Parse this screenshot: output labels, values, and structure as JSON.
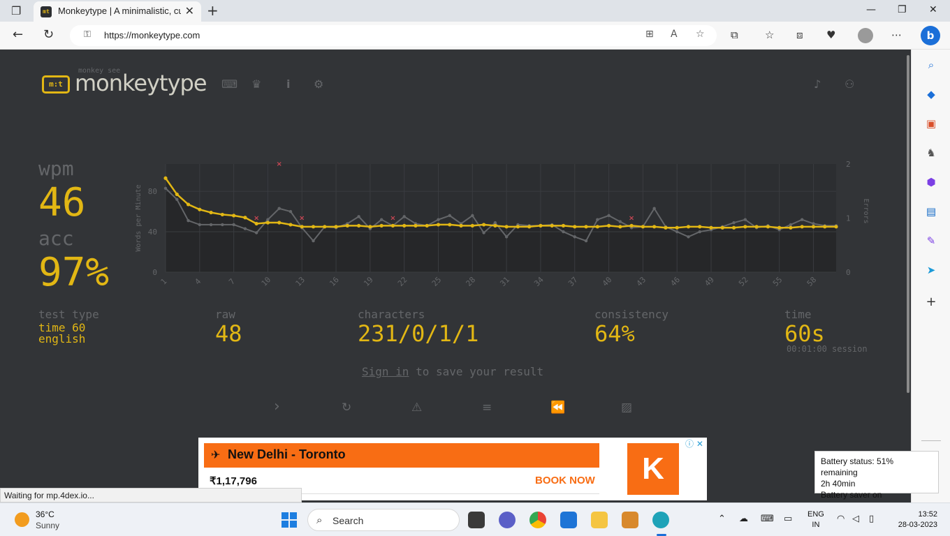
{
  "browser": {
    "tab_title": "Monkeytype | A minimalistic, customizable typing test",
    "favicon_text": "mt",
    "url": "https://monkeytype.com"
  },
  "site": {
    "logo_sub": "monkey see",
    "logo_text": "monkeytype",
    "logo_icon_text": "m:t"
  },
  "results": {
    "wpm_label": "wpm",
    "wpm_value": "46",
    "acc_label": "acc",
    "acc_value": "97%",
    "test_type_label": "test type",
    "test_type_line1": "time 60",
    "test_type_line2": "english",
    "raw_label": "raw",
    "raw_value": "48",
    "characters_label": "characters",
    "characters_value": "231/0/1/1",
    "consistency_label": "consistency",
    "consistency_value": "64%",
    "time_label": "time",
    "time_value": "60s",
    "session_text": "00:01:00 session",
    "sign_in_link": "Sign in",
    "sign_in_rest": " to save your result"
  },
  "chart_data": {
    "type": "line",
    "ylabel": "Words per Minute",
    "y2label": "Errors",
    "ylim": [
      0,
      107
    ],
    "y2lim": [
      0,
      2
    ],
    "yticks": [
      0,
      40,
      80
    ],
    "y2ticks": [
      0,
      1,
      2
    ],
    "xtick_labels": [
      1,
      4,
      7,
      10,
      13,
      16,
      19,
      22,
      25,
      28,
      31,
      34,
      37,
      40,
      43,
      46,
      49,
      52,
      55,
      58
    ],
    "colors": {
      "wpm": "#e2b714",
      "raw": "#646669",
      "errors": "#ca4754"
    },
    "series": [
      {
        "key": "wpm",
        "values": [
          93,
          77,
          67,
          62,
          59,
          57,
          56,
          54,
          48,
          49,
          49,
          47,
          45,
          45,
          45,
          45,
          46,
          46,
          45,
          46,
          46,
          46,
          46,
          46,
          47,
          47,
          46,
          46,
          47,
          46,
          45,
          45,
          45,
          46,
          46,
          46,
          45,
          45,
          45,
          46,
          45,
          46,
          45,
          45,
          44,
          44,
          45,
          45,
          44,
          44,
          44,
          45,
          45,
          45,
          44,
          44,
          45,
          45,
          45,
          45
        ]
      },
      {
        "key": "raw",
        "values": [
          83,
          72,
          51,
          47,
          47,
          47,
          47,
          43,
          39,
          52,
          63,
          60,
          44,
          31,
          45,
          44,
          48,
          55,
          43,
          52,
          46,
          55,
          48,
          46,
          52,
          56,
          48,
          56,
          39,
          49,
          35,
          47,
          46,
          46,
          47,
          40,
          35,
          31,
          52,
          56,
          50,
          44,
          45,
          63,
          45,
          40,
          35,
          40,
          42,
          45,
          49,
          52,
          44,
          46,
          42,
          47,
          52,
          48,
          46,
          46
        ]
      },
      {
        "key": "errors",
        "points": [
          [
            9,
            1
          ],
          [
            11,
            2
          ],
          [
            13,
            1
          ],
          [
            21,
            1
          ],
          [
            42,
            1
          ]
        ]
      }
    ]
  },
  "ad": {
    "route": "New Delhi - Toronto",
    "price": "₹1,17,796",
    "cta": "BOOK NOW",
    "brand_letter": "K",
    "info": "ⓘ ✕"
  },
  "status_text": "Waiting for mp.4dex.io...",
  "battery_tooltip": {
    "line1": "Battery status: 51% remaining",
    "line2": "2h 40min",
    "line3": "Battery saver on"
  },
  "taskbar": {
    "temperature": "36°C",
    "condition": "Sunny",
    "search_placeholder": "Search",
    "lang_line1": "ENG",
    "lang_line2": "IN",
    "time": "13:52",
    "date": "28-03-2023"
  },
  "icons": {
    "tab_close": "✕",
    "new_tab": "+",
    "back": "←",
    "refresh": "↻",
    "lock": "🔒",
    "nav_keyboard": "⌨",
    "nav_crown": "♛",
    "nav_info": "i",
    "nav_settings": "⚙",
    "bell": "🔔",
    "user": "👤",
    "next": "›",
    "restart": "↻",
    "warning": "⚠",
    "words": "≡",
    "replay": "⏪",
    "screenshot": "🖼"
  }
}
